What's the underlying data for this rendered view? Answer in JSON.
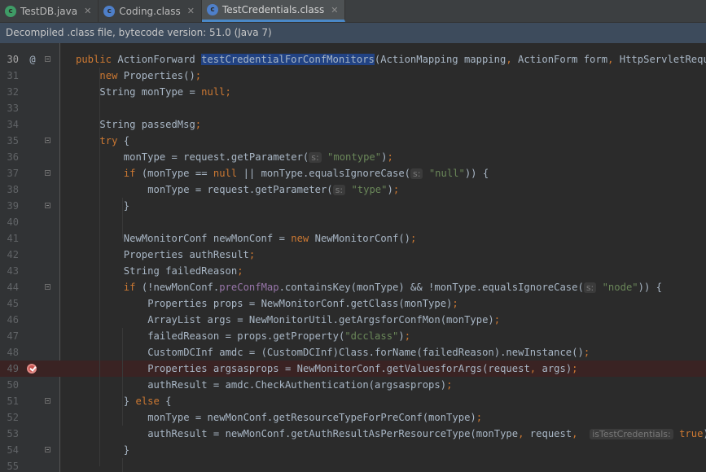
{
  "tabs": [
    {
      "label": "TestDB.java",
      "icon": "java-class-icon",
      "active": false
    },
    {
      "label": "Coding.class",
      "icon": "class-file-icon",
      "active": false
    },
    {
      "label": "TestCredentials.class",
      "icon": "class-file-icon",
      "active": true
    }
  ],
  "banner": {
    "text": "Decompiled .class file, bytecode version: 51.0 (Java 7)"
  },
  "lines": [
    {
      "num": "30",
      "annotation": "@",
      "fold": true,
      "segments": [
        {
          "t": "public",
          "c": "kw"
        },
        {
          "t": " ActionForward ",
          "c": ""
        },
        {
          "t": "testCredentialForConfMonitors",
          "c": "hl"
        },
        {
          "t": "(ActionMapping mapping",
          "c": ""
        },
        {
          "t": ",",
          "c": "kw"
        },
        {
          "t": " ActionForm form",
          "c": ""
        },
        {
          "t": ",",
          "c": "kw"
        },
        {
          "t": " HttpServletRequest r",
          "c": ""
        }
      ]
    },
    {
      "num": "31",
      "indent": 1,
      "segments": [
        {
          "t": "new",
          "c": "kw"
        },
        {
          "t": " Properties()",
          "c": ""
        },
        {
          "t": ";",
          "c": "kw"
        }
      ]
    },
    {
      "num": "32",
      "indent": 1,
      "segments": [
        {
          "t": "String monType = ",
          "c": ""
        },
        {
          "t": "null",
          "c": "kw"
        },
        {
          "t": ";",
          "c": "kw"
        }
      ]
    },
    {
      "num": "33",
      "segments": []
    },
    {
      "num": "34",
      "indent": 1,
      "segments": [
        {
          "t": "String passedMsg",
          "c": ""
        },
        {
          "t": ";",
          "c": "kw"
        }
      ]
    },
    {
      "num": "35",
      "indent": 1,
      "fold": true,
      "segments": [
        {
          "t": "try",
          "c": "kw"
        },
        {
          "t": " {",
          "c": ""
        }
      ]
    },
    {
      "num": "36",
      "indent": 2,
      "segments": [
        {
          "t": "monType = request.getParameter(",
          "c": ""
        },
        {
          "t": "s:",
          "c": "hint"
        },
        {
          "t": " ",
          "c": ""
        },
        {
          "t": "\"montype\"",
          "c": "str"
        },
        {
          "t": ")",
          "c": ""
        },
        {
          "t": ";",
          "c": "kw"
        }
      ]
    },
    {
      "num": "37",
      "indent": 2,
      "fold": true,
      "segments": [
        {
          "t": "if",
          "c": "kw"
        },
        {
          "t": " (monType == ",
          "c": ""
        },
        {
          "t": "null",
          "c": "kw"
        },
        {
          "t": " || monType.equalsIgnoreCase(",
          "c": ""
        },
        {
          "t": "s:",
          "c": "hint"
        },
        {
          "t": " ",
          "c": ""
        },
        {
          "t": "\"null\"",
          "c": "str"
        },
        {
          "t": ")) {",
          "c": ""
        }
      ]
    },
    {
      "num": "38",
      "indent": 3,
      "segments": [
        {
          "t": "monType = request.getParameter(",
          "c": ""
        },
        {
          "t": "s:",
          "c": "hint"
        },
        {
          "t": " ",
          "c": ""
        },
        {
          "t": "\"type\"",
          "c": "str"
        },
        {
          "t": ")",
          "c": ""
        },
        {
          "t": ";",
          "c": "kw"
        }
      ]
    },
    {
      "num": "39",
      "indent": 2,
      "fold": true,
      "segments": [
        {
          "t": "}",
          "c": ""
        }
      ]
    },
    {
      "num": "40",
      "segments": []
    },
    {
      "num": "41",
      "indent": 2,
      "segments": [
        {
          "t": "NewMonitorConf newMonConf = ",
          "c": ""
        },
        {
          "t": "new",
          "c": "kw"
        },
        {
          "t": " NewMonitorConf()",
          "c": ""
        },
        {
          "t": ";",
          "c": "kw"
        }
      ]
    },
    {
      "num": "42",
      "indent": 2,
      "segments": [
        {
          "t": "Properties authResult",
          "c": ""
        },
        {
          "t": ";",
          "c": "kw"
        }
      ]
    },
    {
      "num": "43",
      "indent": 2,
      "segments": [
        {
          "t": "String failedReason",
          "c": ""
        },
        {
          "t": ";",
          "c": "kw"
        }
      ]
    },
    {
      "num": "44",
      "indent": 2,
      "fold": true,
      "segments": [
        {
          "t": "if",
          "c": "kw"
        },
        {
          "t": " (!newMonConf.",
          "c": ""
        },
        {
          "t": "preConfMap",
          "c": "fld"
        },
        {
          "t": ".containsKey(monType) && !monType.equalsIgnoreCase(",
          "c": ""
        },
        {
          "t": "s:",
          "c": "hint"
        },
        {
          "t": " ",
          "c": ""
        },
        {
          "t": "\"node\"",
          "c": "str"
        },
        {
          "t": ")) {",
          "c": ""
        }
      ]
    },
    {
      "num": "45",
      "indent": 3,
      "segments": [
        {
          "t": "Properties props = NewMonitorConf.getClass(monType)",
          "c": ""
        },
        {
          "t": ";",
          "c": "kw"
        }
      ]
    },
    {
      "num": "46",
      "indent": 3,
      "segments": [
        {
          "t": "ArrayList args = NewMonitorUtil.getArgsforConfMon(monType)",
          "c": ""
        },
        {
          "t": ";",
          "c": "kw"
        }
      ]
    },
    {
      "num": "47",
      "indent": 3,
      "segments": [
        {
          "t": "failedReason = props.getProperty(",
          "c": ""
        },
        {
          "t": "\"dcclass\"",
          "c": "str"
        },
        {
          "t": ")",
          "c": ""
        },
        {
          "t": ";",
          "c": "kw"
        }
      ]
    },
    {
      "num": "48",
      "indent": 3,
      "segments": [
        {
          "t": "CustomDCInf amdc = (CustomDCInf)Class.forName(failedReason).newInstance()",
          "c": ""
        },
        {
          "t": ";",
          "c": "kw"
        }
      ]
    },
    {
      "num": "49",
      "indent": 3,
      "breakpoint": true,
      "segments": [
        {
          "t": "Properties argsasprops = NewMonitorConf.getValuesforArgs(request",
          "c": ""
        },
        {
          "t": ",",
          "c": "kw"
        },
        {
          "t": " args)",
          "c": ""
        },
        {
          "t": ";",
          "c": "kw"
        }
      ]
    },
    {
      "num": "50",
      "indent": 3,
      "segments": [
        {
          "t": "authResult = amdc.CheckAuthentication(argsasprops)",
          "c": ""
        },
        {
          "t": ";",
          "c": "kw"
        }
      ]
    },
    {
      "num": "51",
      "indent": 2,
      "fold": true,
      "segments": [
        {
          "t": "} ",
          "c": ""
        },
        {
          "t": "else",
          "c": "kw"
        },
        {
          "t": " {",
          "c": ""
        }
      ]
    },
    {
      "num": "52",
      "indent": 3,
      "segments": [
        {
          "t": "monType = newMonConf.getResourceTypeForPreConf(monType)",
          "c": ""
        },
        {
          "t": ";",
          "c": "kw"
        }
      ]
    },
    {
      "num": "53",
      "indent": 3,
      "segments": [
        {
          "t": "authResult = newMonConf.getAuthResultAsPerResourceType(monType",
          "c": ""
        },
        {
          "t": ",",
          "c": "kw"
        },
        {
          "t": " request",
          "c": ""
        },
        {
          "t": ",",
          "c": "kw"
        },
        {
          "t": "  ",
          "c": ""
        },
        {
          "t": "isTestCredentials:",
          "c": "hint"
        },
        {
          "t": " ",
          "c": ""
        },
        {
          "t": "true",
          "c": "kw"
        },
        {
          "t": ")",
          "c": ""
        },
        {
          "t": ";",
          "c": "kw"
        }
      ]
    },
    {
      "num": "54",
      "indent": 2,
      "fold": true,
      "segments": [
        {
          "t": "}",
          "c": ""
        }
      ]
    },
    {
      "num": "55",
      "segments": []
    }
  ]
}
